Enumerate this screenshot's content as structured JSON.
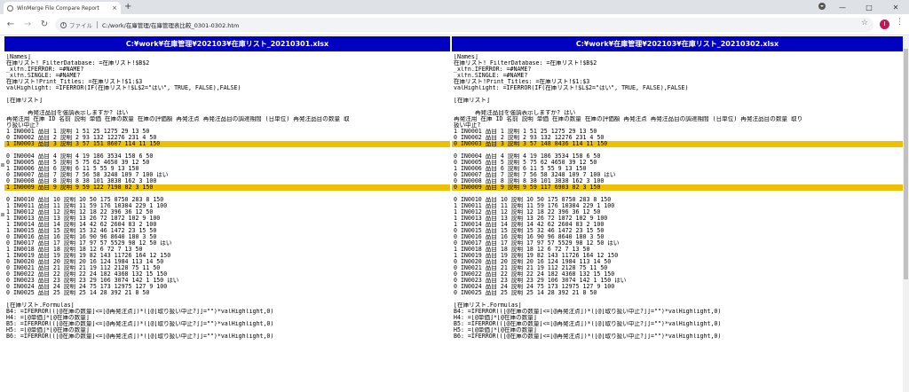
{
  "browser": {
    "tab_title": "WinMerge File Compare Report",
    "tab_close": "×",
    "new_tab": "+",
    "address_label": "ファイル",
    "address_path": "C:/work/在庫管理/在庫管理表比較_0301-0302.htm",
    "profile_initial": "I"
  },
  "report": {
    "left": {
      "title": "C:¥work¥在庫管理¥202103¥在庫リスト_20210301.xlsx",
      "lines": [
        {
          "text": "[Names]",
          "diff": false
        },
        {
          "text": "在庫リスト!_FilterDatabase: =在庫リスト!$B$2",
          "diff": false
        },
        {
          "text": "_xlfn.IFERROR: =#NAME?",
          "diff": false
        },
        {
          "text": "_xlfn.SINGLE: =#NAME?",
          "diff": false
        },
        {
          "text": "在庫リスト!Print_Titles: =在庫リスト!$1:$3",
          "diff": false
        },
        {
          "text": "valHighlight: =IFERROR(IF(在庫リスト!$L$2=\"はい\", TRUE, FALSE),FALSE)",
          "diff": false
        },
        {
          "text": "",
          "diff": false
        },
        {
          "text": "[在庫リスト]",
          "diff": false
        },
        {
          "text": "",
          "diff": false
        },
        {
          "text": "      再発注品目を強調表示しますか? はい",
          "diff": false
        },
        {
          "text": "再発注用 在庫 ID 名前 説明 単価 在庫の数量 在庫の評価額 再発注点 再発注品目の調達期間 (日単位) 再発注品目の数量 取",
          "diff": false
        },
        {
          "text": "り扱い中止?",
          "diff": false
        },
        {
          "text": "1 IN0001 品目 1 説明 1 51 25 1275 29 13 50",
          "diff": false
        },
        {
          "text": "0 IN0002 品目 2 説明 2 93 132 12276 231 4 50",
          "diff": false
        },
        {
          "text": "1 IN0003 品目 3 説明 3 57 151 8607 114 11 150",
          "diff": true
        },
        {
          "text": "",
          "diff": false
        },
        {
          "text": "0 IN0004 品目 4 説明 4 19 186 3534 158 6 50",
          "diff": false
        },
        {
          "text": "0 IN0005 品目 5 説明 5 75 62 4650 39 12 50",
          "diff": false
        },
        {
          "text": "1 IN0006 品目 6 説明 6 11 5 55 9 13 150",
          "diff": false
        },
        {
          "text": "0 IN0007 品目 7 説明 7 56 58 3248 109 7 100 はい",
          "diff": false
        },
        {
          "text": "0 IN0008 品目 8 説明 8 38 101 3838 162 3 100",
          "diff": false
        },
        {
          "text": "1 IN0009 品目 9 説明 9 59 122 7198 82 3 150",
          "diff": true
        },
        {
          "text": "",
          "diff": false
        },
        {
          "text": "0 IN0010 品目 10 説明 10 50 175 8750 283 8 150",
          "diff": false
        },
        {
          "text": "1 IN0011 品目 11 説明 11 59 176 10384 229 1 100",
          "diff": false
        },
        {
          "text": "1 IN0012 品目 12 説明 12 18 22 396 36 12 50",
          "diff": false
        },
        {
          "text": "1 IN0013 品目 13 説明 13 26 72 1872 102 9 100",
          "diff": false
        },
        {
          "text": "1 IN0014 品目 14 説明 14 42 62 2604 83 2 100",
          "diff": false
        },
        {
          "text": "1 IN0015 品目 15 説明 15 32 46 1472 23 15 50",
          "diff": false
        },
        {
          "text": "0 IN0016 品目 16 説明 16 90 96 8640 180 3 50",
          "diff": false
        },
        {
          "text": "0 IN0017 品目 17 説明 17 97 57 5529 98 12 50 はい",
          "diff": false
        },
        {
          "text": "1 IN0018 品目 18 説明 18 12 6 72 7 13 50",
          "diff": false
        },
        {
          "text": "1 IN0019 品目 19 説明 19 82 143 11726 164 12 150",
          "diff": false
        },
        {
          "text": "0 IN0020 品目 20 説明 20 16 124 1984 113 14 50",
          "diff": false
        },
        {
          "text": "0 IN0021 品目 21 説明 21 19 112 2128 75 11 50",
          "diff": false
        },
        {
          "text": "0 IN0022 品目 22 説明 22 24 182 4368 132 15 150",
          "diff": false
        },
        {
          "text": "0 IN0023 品目 23 説明 23 29 106 3074 142 1 150 はい",
          "diff": false
        },
        {
          "text": "0 IN0024 品目 24 説明 24 75 173 12975 127 9 100",
          "diff": false
        },
        {
          "text": "0 IN0025 品目 25 説明 25 14 28 392 21 8 50",
          "diff": false
        },
        {
          "text": "",
          "diff": false
        },
        {
          "text": "[在庫リスト.Formulas]",
          "diff": false
        },
        {
          "text": "B4: =IFERROR(([@在庫の数量]<=[@再発注点])*([@[取り扱い中止?]]=\"\")*valHighlight,0)",
          "diff": false
        },
        {
          "text": "H4: =[@単価]*[@在庫の数量]",
          "diff": false
        },
        {
          "text": "B5: =IFERROR(([@在庫の数量]<=[@再発注点])*([@[取り扱い中止?]]=\"\")*valHighlight,0)",
          "diff": false
        },
        {
          "text": "H5: =[@単価]*[@在庫の数量]",
          "diff": false
        },
        {
          "text": "B6: =IFERROR(([@在庫の数量]<=[@再発注点])*([@[取り扱い中止?]]=\"\")*valHighlight,0)",
          "diff": false
        }
      ]
    },
    "right": {
      "title": "C:¥work¥在庫管理¥202103¥在庫リスト_20210302.xlsx",
      "lines": [
        {
          "text": "[Names]",
          "diff": false
        },
        {
          "text": "在庫リスト!_FilterDatabase: =在庫リスト!$B$2",
          "diff": false
        },
        {
          "text": "_xlfn.IFERROR: =#NAME?",
          "diff": false
        },
        {
          "text": "_xlfn.SINGLE: =#NAME?",
          "diff": false
        },
        {
          "text": "在庫リスト!Print_Titles: =在庫リスト!$1:$3",
          "diff": false
        },
        {
          "text": "valHighlight: =IFERROR(IF(在庫リスト!$L$2=\"はい\", TRUE, FALSE),FALSE)",
          "diff": false
        },
        {
          "text": "",
          "diff": false
        },
        {
          "text": "[在庫リスト]",
          "diff": false
        },
        {
          "text": "",
          "diff": false
        },
        {
          "text": "      再発注品目を強調表示しますか? はい",
          "diff": false
        },
        {
          "text": "再発注用 在庫 ID 名前 説明 単価 在庫の数量 在庫の評価額 再発注点 再発注品目の調達期間 (日単位) 再発注品目の数量 取り",
          "diff": false
        },
        {
          "text": "扱い中止?",
          "diff": false
        },
        {
          "text": "1 IN0001 品目 1 説明 1 51 25 1275 29 13 50",
          "diff": false
        },
        {
          "text": "0 IN0002 品目 2 説明 2 93 132 12276 231 4 50",
          "diff": false
        },
        {
          "text": "0 IN0003 品目 3 説明 3 57 148 8436 114 11 150",
          "diff": true
        },
        {
          "text": "",
          "diff": false
        },
        {
          "text": "0 IN0004 品目 4 説明 4 19 186 3534 158 6 50",
          "diff": false
        },
        {
          "text": "0 IN0005 品目 5 説明 5 75 62 4650 39 12 50",
          "diff": false
        },
        {
          "text": "1 IN0006 品目 6 説明 6 11 5 55 9 13 150",
          "diff": false
        },
        {
          "text": "0 IN0007 品目 7 説明 7 56 58 3248 109 7 100 はい",
          "diff": false
        },
        {
          "text": "0 IN0008 品目 8 説明 8 38 101 3838 162 3 100",
          "diff": false
        },
        {
          "text": "0 IN0009 品目 9 説明 9 59 117 6903 82 3 150",
          "diff": true
        },
        {
          "text": "",
          "diff": false
        },
        {
          "text": "0 IN0010 品目 10 説明 10 50 175 8750 283 8 150",
          "diff": false
        },
        {
          "text": "1 IN0011 品目 11 説明 11 59 176 10384 229 1 100",
          "diff": false
        },
        {
          "text": "1 IN0012 品目 12 説明 12 18 22 396 36 12 50",
          "diff": false
        },
        {
          "text": "1 IN0013 品目 13 説明 13 26 72 1872 102 9 100",
          "diff": false
        },
        {
          "text": "1 IN0014 品目 14 説明 14 42 62 2604 83 2 100",
          "diff": false
        },
        {
          "text": "0 IN0015 品目 15 説明 15 32 46 1472 23 15 50",
          "diff": false
        },
        {
          "text": "0 IN0016 品目 16 説明 16 90 96 8640 180 3 50",
          "diff": false
        },
        {
          "text": "0 IN0017 品目 17 説明 17 97 57 5529 98 12 50 はい",
          "diff": false
        },
        {
          "text": "1 IN0018 品目 18 説明 18 12 6 72 7 13 50",
          "diff": false
        },
        {
          "text": "1 IN0019 品目 19 説明 19 82 143 11726 164 12 150",
          "diff": false
        },
        {
          "text": "0 IN0020 品目 20 説明 20 16 124 1984 113 14 50",
          "diff": false
        },
        {
          "text": "0 IN0021 品目 21 説明 21 19 112 2128 75 11 50",
          "diff": false
        },
        {
          "text": "0 IN0022 品目 22 説明 22 24 182 4368 132 15 150",
          "diff": false
        },
        {
          "text": "0 IN0023 品目 23 説明 23 29 106 3074 142 1 150 はい",
          "diff": false
        },
        {
          "text": "0 IN0024 品目 24 説明 24 75 173 12975 127 9 100",
          "diff": false
        },
        {
          "text": "0 IN0025 品目 25 説明 25 14 28 392 21 8 50",
          "diff": false
        },
        {
          "text": "",
          "diff": false
        },
        {
          "text": "[在庫リスト.Formulas]",
          "diff": false
        },
        {
          "text": "B4: =IFERROR(([@在庫の数量]<=[@再発注点])*([@[取り扱い中止?]]=\"\")*valHighlight,0)",
          "diff": false
        },
        {
          "text": "H4: =[@単価]*[@在庫の数量]",
          "diff": false
        },
        {
          "text": "B5: =IFERROR(([@在庫の数量]<=[@再発注点])*([@[取り扱い中止?]]=\"\")*valHighlight,0)",
          "diff": false
        },
        {
          "text": "H5: =[@単価]*[@在庫の数量]",
          "diff": false
        },
        {
          "text": "B6: =IFERROR(([@在庫の数量]<=[@再発注点])*([@[取り扱い中止?]]=\"\")*valHighlight,0)",
          "diff": false
        }
      ]
    },
    "colors": {
      "header_bg": "#0000c0",
      "diff_highlight": "#efc000"
    }
  }
}
